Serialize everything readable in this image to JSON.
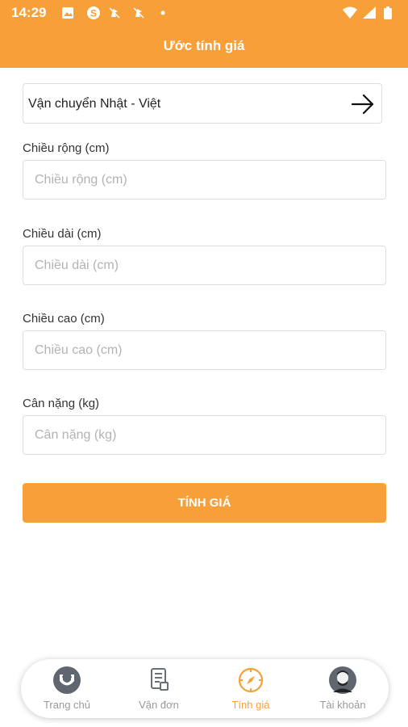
{
  "status_bar": {
    "time": "14:29",
    "icons_left": [
      "image-icon",
      "skype-icon",
      "muted-notification-icon",
      "muted-notification-icon",
      "dot-icon"
    ],
    "icons_right": [
      "wifi-icon",
      "signal-icon",
      "battery-icon"
    ]
  },
  "header": {
    "title": "Ước tính giá"
  },
  "route": {
    "label": "Vận chuyển Nhật - Việt",
    "icon": "arrow-right-icon"
  },
  "form": {
    "width": {
      "label": "Chiều rộng (cm)",
      "placeholder": "Chiều rộng (cm)",
      "value": ""
    },
    "length": {
      "label": "Chiều dài (cm)",
      "placeholder": "Chiều dài (cm)",
      "value": ""
    },
    "height": {
      "label": "Chiều cao (cm)",
      "placeholder": "Chiều cao (cm)",
      "value": ""
    },
    "weight": {
      "label": "Cân nặng (kg)",
      "placeholder": "Cân nặng (kg)",
      "value": ""
    },
    "submit_label": "TÍNH GIÁ"
  },
  "bottom_nav": {
    "items": [
      {
        "label": "Trang chủ",
        "icon": "home-logo-icon",
        "active": false
      },
      {
        "label": "Vận đơn",
        "icon": "document-icon",
        "active": false
      },
      {
        "label": "Tính giá",
        "icon": "compass-icon",
        "active": true
      },
      {
        "label": "Tài khoản",
        "icon": "user-avatar-icon",
        "active": false
      }
    ]
  },
  "colors": {
    "accent": "#f7a03a",
    "inactive_text": "#9a9a9a",
    "border": "#dedede"
  }
}
